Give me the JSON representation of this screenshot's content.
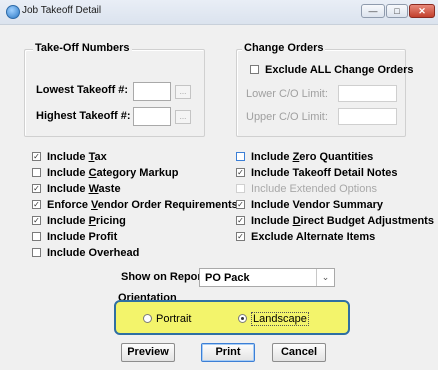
{
  "window": {
    "title": "Job Takeoff Detail",
    "controls": {
      "minimize": "—",
      "maximize": "□",
      "close": "✕"
    }
  },
  "takeoff": {
    "legend": "Take-Off Numbers",
    "lowest_label": "Lowest Takeoff #:",
    "highest_label": "Highest Takeoff #:",
    "lowest_value": "",
    "highest_value": "",
    "browse_label": "..."
  },
  "change_orders": {
    "legend": "Change Orders",
    "exclude_all_label": "Exclude ALL Change Orders",
    "exclude_all_checked": false,
    "lower_label": "Lower C/O Limit:",
    "upper_label": "Upper C/O Limit:"
  },
  "options_left": [
    {
      "pre": "Include ",
      "u": "T",
      "post": "ax",
      "checked": true
    },
    {
      "pre": "Include ",
      "u": "C",
      "post": "ategory Markup",
      "checked": false
    },
    {
      "pre": "Include ",
      "u": "W",
      "post": "aste",
      "checked": true
    },
    {
      "pre": "Enforce ",
      "u": "V",
      "post": "endor Order Requirements",
      "checked": true
    },
    {
      "pre": "Include ",
      "u": "P",
      "post": "ricing",
      "checked": true
    },
    {
      "pre": "Include Profit",
      "u": "",
      "post": "",
      "checked": false
    },
    {
      "pre": "Include Overhead",
      "u": "",
      "post": "",
      "checked": false
    }
  ],
  "options_right": [
    {
      "pre": "Include ",
      "u": "Z",
      "post": "ero Quantities",
      "checked": false
    },
    {
      "pre": "Include Takeoff Detail Notes",
      "u": "",
      "post": "",
      "checked": true
    },
    {
      "pre": "Include Extended Options",
      "u": "",
      "post": "",
      "checked": false
    },
    {
      "pre": "Include Vendor Summary",
      "u": "",
      "post": "",
      "checked": true
    },
    {
      "pre": "Include ",
      "u": "D",
      "post": "irect Budget Adjustments",
      "checked": true
    },
    {
      "pre": "Exclude Alternate Items",
      "u": "",
      "post": "",
      "checked": true
    }
  ],
  "report": {
    "label": "Show on Report:",
    "selected": "PO Pack"
  },
  "orientation": {
    "legend": "Orientation",
    "portrait": "Portrait",
    "landscape": "Landscape",
    "selected": "landscape"
  },
  "buttons": {
    "preview": "Preview",
    "print": "Print",
    "cancel": "Cancel"
  },
  "colors": {
    "highlight": "#f3f46b",
    "highlight_border": "#2f6fa2",
    "focus_blue": "#3c7fd6"
  }
}
